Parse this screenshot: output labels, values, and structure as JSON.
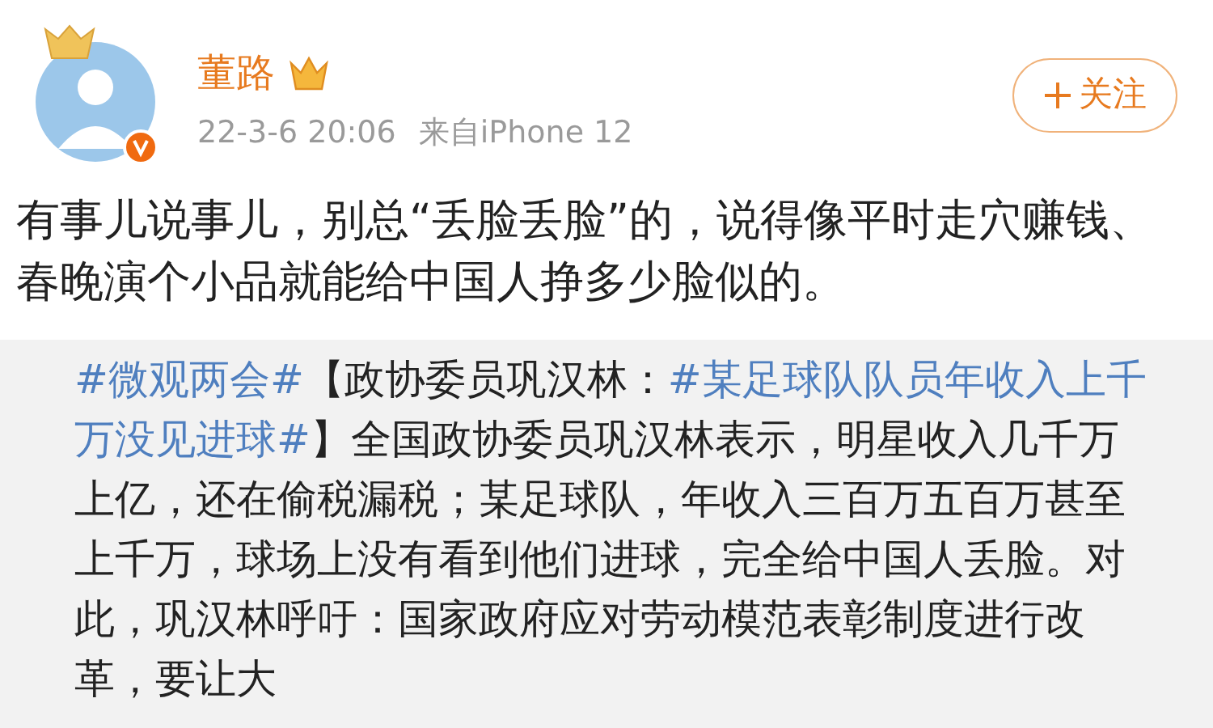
{
  "post": {
    "author": {
      "name": "董路",
      "verified": true
    },
    "time": "22-3-6 20:06",
    "source": "来自iPhone 12",
    "follow_button": {
      "label": "关注"
    },
    "text": "有事儿说事儿，别总“丢脸丢脸”的，说得像平时走穴赚钱、春晚演个小品就能给中国人挣多少脸似的。",
    "repost": {
      "segments": [
        {
          "kind": "hashtag",
          "text": "#微观两会#"
        },
        {
          "kind": "plain",
          "text": "【政协委员巩汉林："
        },
        {
          "kind": "hashtag",
          "text": "#某足球队队员年收入上千万没见进球#"
        },
        {
          "kind": "plain",
          "text": "】全国政协委员巩汉林表示，明星收入几千万上亿，还在偷税漏税；某足球队，年收入三百万五百万甚至上千万，球场上没有看到他们进球，完全给中国人丢脸。对此，巩汉林呼吁：国家政府应对劳动模范表彰制度进行改革，要让大"
        }
      ]
    }
  }
}
